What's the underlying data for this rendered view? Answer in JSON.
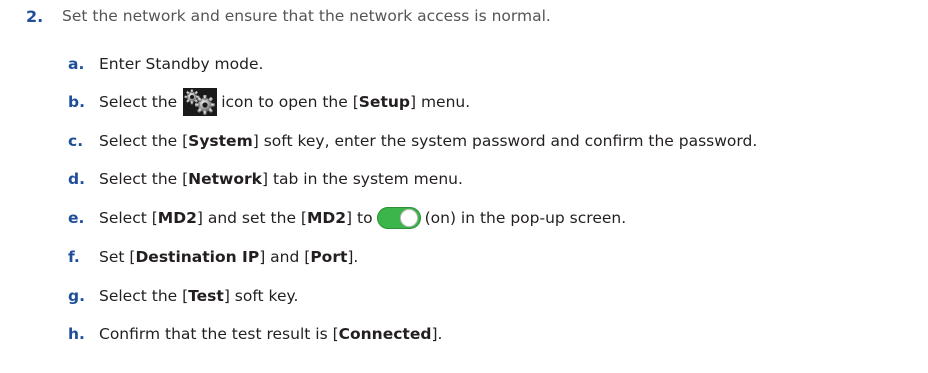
{
  "step": {
    "number": "2.",
    "text": "Set the network and ensure that the network access is normal."
  },
  "substeps": {
    "a": {
      "letter": "a.",
      "text": "Enter Standby mode."
    },
    "b": {
      "letter": "b.",
      "pre": "Select the",
      "icon": "setup-gear-icon",
      "post": " icon to open the [",
      "keyword": "Setup",
      "end": "] menu."
    },
    "c": {
      "letter": "c.",
      "pre": "Select the [",
      "keyword": "System",
      "post": "] soft key, enter the system password and confirm the password."
    },
    "d": {
      "letter": "d.",
      "pre": "Select the [",
      "keyword": "Network",
      "post": "] tab in the system menu."
    },
    "e": {
      "letter": "e.",
      "pre": "Select [",
      "keyword1": "MD2",
      "mid": "] and set the [",
      "keyword2": "MD2",
      "before_icon": "] to",
      "icon": "toggle-on-icon",
      "post": "(on) in the pop-up screen."
    },
    "f": {
      "letter": "f.",
      "pre": "Set [",
      "keyword1": "Destination IP",
      "mid": "] and [",
      "keyword2": "Port",
      "post": "]."
    },
    "g": {
      "letter": "g.",
      "pre": "Select the [",
      "keyword": "Test",
      "post": "] soft key."
    },
    "h": {
      "letter": "h.",
      "pre": "Confirm that the test result is [",
      "keyword": "Connected",
      "post": "]."
    }
  },
  "colors": {
    "step_number": "#1f4e9a",
    "step_text": "#555555",
    "body_text": "#231f20",
    "toggle_on": "#3cb64a",
    "icon_background": "#1a1a1a"
  }
}
